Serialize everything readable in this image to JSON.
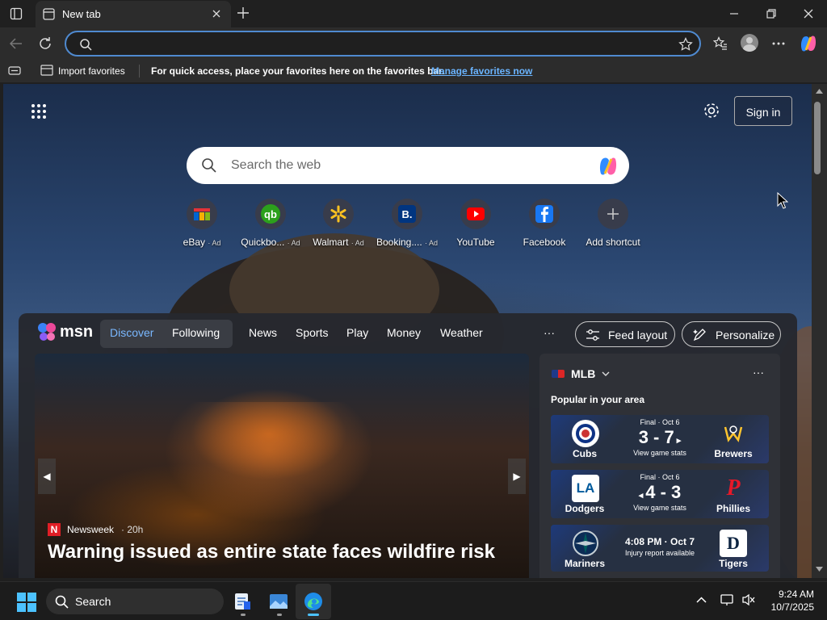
{
  "browser": {
    "tab_title": "New tab",
    "address_value": "",
    "favorites_bar": {
      "import_label": "Import favorites",
      "message": "For quick access, place your favorites here on the favorites bar.",
      "manage_link": "Manage favorites now"
    }
  },
  "newtab": {
    "sign_in_label": "Sign in",
    "search_placeholder": "Search the web",
    "shortcuts": [
      {
        "label": "eBay",
        "ad": "· Ad",
        "icon": "ebay-icon"
      },
      {
        "label": "Quickbo...",
        "ad": "· Ad",
        "icon": "quickbooks-icon"
      },
      {
        "label": "Walmart",
        "ad": "· Ad",
        "icon": "walmart-icon"
      },
      {
        "label": "Booking....",
        "ad": "· Ad",
        "icon": "booking-icon"
      },
      {
        "label": "YouTube",
        "ad": "",
        "icon": "youtube-icon"
      },
      {
        "label": "Facebook",
        "ad": "",
        "icon": "facebook-icon"
      },
      {
        "label": "Add shortcut",
        "ad": "",
        "icon": "plus-icon"
      }
    ]
  },
  "msn": {
    "brand": "msn",
    "tabs": [
      "Discover",
      "Following"
    ],
    "nav": [
      "News",
      "Sports",
      "Play",
      "Money",
      "Weather"
    ],
    "more": "···",
    "feed_layout_label": "Feed layout",
    "personalize_label": "Personalize",
    "hero": {
      "source": "Newsweek",
      "age": "· 20h",
      "headline": "Warning issued as entire state faces wildfire risk"
    },
    "mlb": {
      "title": "MLB",
      "subtitle": "Popular in your area",
      "games": [
        {
          "status": "Final · Oct 6",
          "score": "3 - 7",
          "link": "View game stats",
          "home": "Cubs",
          "away": "Brewers"
        },
        {
          "status": "Final · Oct 6",
          "score": "4 - 3",
          "link": "View game stats",
          "home": "Dodgers",
          "away": "Phillies"
        },
        {
          "status": "4:08 PM · Oct 7",
          "score": "",
          "link": "Injury report available",
          "home": "Mariners",
          "away": "Tigers"
        }
      ]
    }
  },
  "taskbar": {
    "search_label": "Search",
    "time": "9:24 AM",
    "date": "10/7/2025"
  }
}
